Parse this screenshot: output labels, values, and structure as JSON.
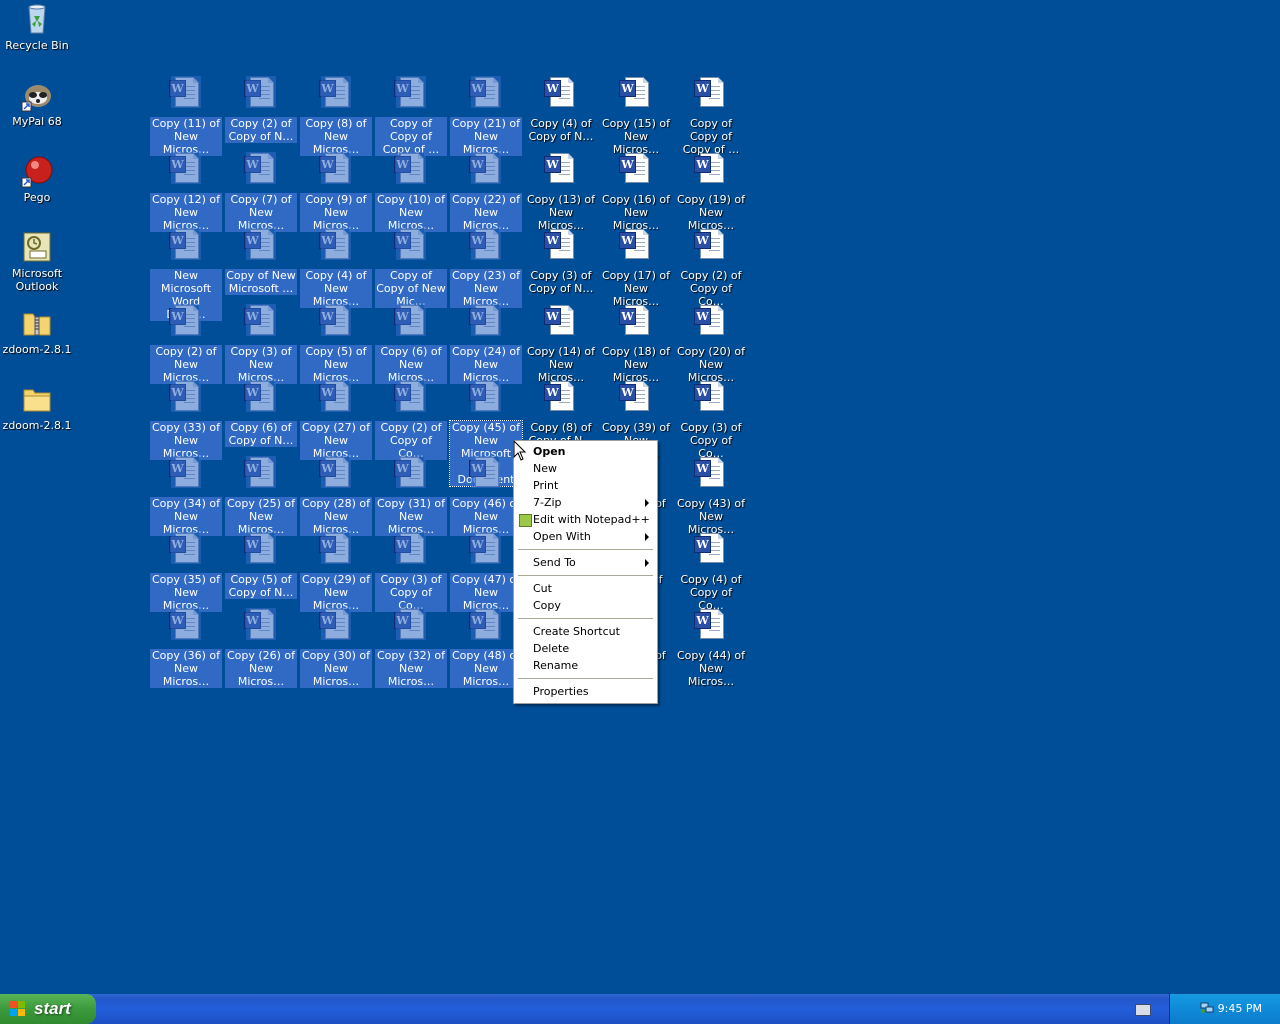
{
  "desktop": {
    "system_icons": [
      {
        "label": "Recycle Bin",
        "icon": "recycle-bin-icon"
      },
      {
        "label": "MyPal 68",
        "icon": "mypal-raccoon-icon"
      },
      {
        "label": "Pego",
        "icon": "pego-red-ball-icon"
      },
      {
        "label": "Microsoft Outlook",
        "icon": "outlook-icon"
      },
      {
        "label": "zdoom-2.8.1",
        "icon": "zipped-folder-icon"
      },
      {
        "label": "zdoom-2.8.1",
        "icon": "folder-icon"
      }
    ],
    "documents": [
      {
        "label": "Copy (11) of New Micros…"
      },
      {
        "label": "Copy (2) of Copy of N…"
      },
      {
        "label": "Copy (8) of New Micros…"
      },
      {
        "label": "Copy of Copy of Copy of …"
      },
      {
        "label": "Copy (21) of New Micros…"
      },
      {
        "label": "Copy (4) of Copy of N…"
      },
      {
        "label": "Copy (15) of New Micros…"
      },
      {
        "label": "Copy of Copy of Copy of …"
      },
      {
        "label": "Copy (12) of New Micros…"
      },
      {
        "label": "Copy (7) of New Micros…"
      },
      {
        "label": "Copy (9) of New Micros…"
      },
      {
        "label": "Copy (10) of New Micros…"
      },
      {
        "label": "Copy (22) of New Micros…"
      },
      {
        "label": "Copy (13) of New Micros…"
      },
      {
        "label": "Copy (16) of New Micros…"
      },
      {
        "label": "Copy (19) of New Micros…"
      },
      {
        "label": "New Microsoft Word Docu…"
      },
      {
        "label": "Copy of New Microsoft …"
      },
      {
        "label": "Copy (4) of New Micros…"
      },
      {
        "label": "Copy of Copy of New Mic…"
      },
      {
        "label": "Copy (23) of New Micros…"
      },
      {
        "label": "Copy (3) of Copy of N…"
      },
      {
        "label": "Copy (17) of New Micros…"
      },
      {
        "label": "Copy (2) of Copy of Co…"
      },
      {
        "label": "Copy (2) of New Micros…"
      },
      {
        "label": "Copy (3) of New Micros…"
      },
      {
        "label": "Copy (5) of New Micros…"
      },
      {
        "label": "Copy (6) of New Micros…"
      },
      {
        "label": "Copy (24) of New Micros…"
      },
      {
        "label": "Copy (14) of New Micros…"
      },
      {
        "label": "Copy (18) of New Micros…"
      },
      {
        "label": "Copy (20) of New Micros…"
      },
      {
        "label": "Copy (33) of New Micros…"
      },
      {
        "label": "Copy (6) of Copy of N…"
      },
      {
        "label": "Copy (27) of New Micros…"
      },
      {
        "label": "Copy (2) of Copy of Co…"
      },
      {
        "label": "Copy (45) of New Microsoft Word Document"
      },
      {
        "label": "Copy (8) of Copy of N…"
      },
      {
        "label": "Copy (39) of New Micros…"
      },
      {
        "label": "Copy (3) of Copy of Co…"
      },
      {
        "label": "Copy (34) of New Micros…"
      },
      {
        "label": "Copy (25) of New Micros…"
      },
      {
        "label": "Copy (28) of New Micros…"
      },
      {
        "label": "Copy (31) of New Micros…"
      },
      {
        "label": "Copy (46) of New Micros…"
      },
      {
        "label": ""
      },
      {
        "label": "…of"
      },
      {
        "label": "Copy (43) of New Micros…"
      },
      {
        "label": "Copy (35) of New Micros…"
      },
      {
        "label": "Copy (5) of Copy of N…"
      },
      {
        "label": "Copy (29) of New Micros…"
      },
      {
        "label": "Copy (3) of Copy of Co…"
      },
      {
        "label": "Copy (47) of New Micros…"
      },
      {
        "label": ""
      },
      {
        "label": "…f"
      },
      {
        "label": "Copy (4) of Copy of Co…"
      },
      {
        "label": "Copy (36) of New Micros…"
      },
      {
        "label": "Copy (26) of New Micros…"
      },
      {
        "label": "Copy (30) of New Micros…"
      },
      {
        "label": "Copy (32) of New Micros…"
      },
      {
        "label": "Copy (48) of New Micros…"
      },
      {
        "label": ""
      },
      {
        "label": "…of"
      },
      {
        "label": "Copy (44) of New Micros…"
      }
    ]
  },
  "context_menu": {
    "items": [
      {
        "label": "Open",
        "bold": true
      },
      {
        "label": "New"
      },
      {
        "label": "Print"
      },
      {
        "label": "7-Zip",
        "submenu": true
      },
      {
        "label": "Edit with Notepad++",
        "icon": "notepadpp-icon"
      },
      {
        "label": "Open With",
        "submenu": true
      },
      {
        "separator": true
      },
      {
        "label": "Send To",
        "submenu": true
      },
      {
        "separator": true
      },
      {
        "label": "Cut"
      },
      {
        "label": "Copy"
      },
      {
        "separator": true
      },
      {
        "label": "Create Shortcut"
      },
      {
        "label": "Delete"
      },
      {
        "label": "Rename"
      },
      {
        "separator": true
      },
      {
        "label": "Properties"
      }
    ]
  },
  "taskbar": {
    "start_label": "start",
    "clock": "9:45 PM"
  },
  "colors": {
    "desktop": "#004e98",
    "selection": "#316ac5",
    "taskbar": "#245edb",
    "start_button": "#3c9a3c",
    "tray": "#0f8ad8"
  }
}
